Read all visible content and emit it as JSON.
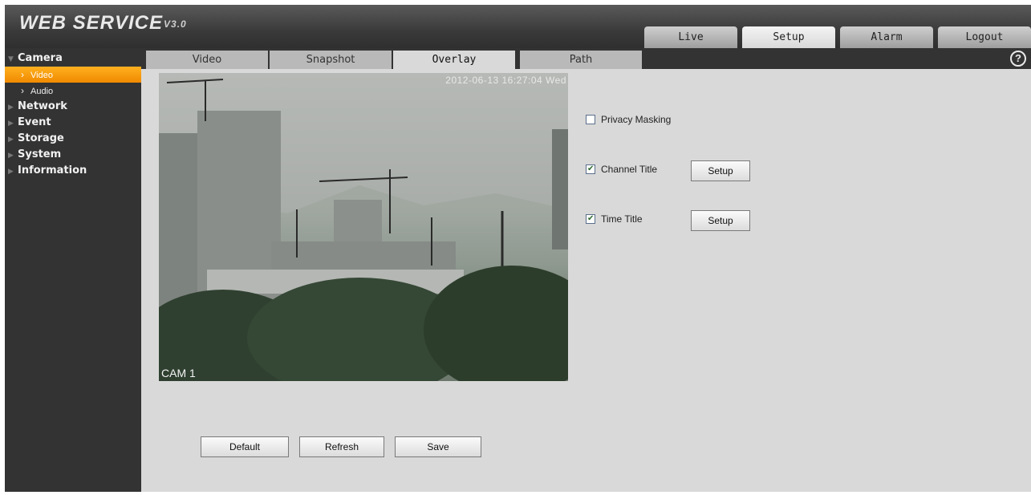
{
  "header": {
    "logo": "WEB SERVICE",
    "version": "V3.0",
    "nav": [
      "Live",
      "Setup",
      "Alarm",
      "Logout"
    ],
    "active_nav": "Setup"
  },
  "sidebar": {
    "sections": [
      {
        "label": "Camera",
        "expanded": true,
        "items": [
          {
            "label": "Video",
            "active": true
          },
          {
            "label": "Audio",
            "active": false
          }
        ]
      },
      {
        "label": "Network"
      },
      {
        "label": "Event"
      },
      {
        "label": "Storage"
      },
      {
        "label": "System"
      },
      {
        "label": "Information"
      }
    ]
  },
  "tabs": [
    "Video",
    "Snapshot",
    "Overlay",
    "Path"
  ],
  "active_tab": "Overlay",
  "help_label": "?",
  "video": {
    "time_osd": "2012-06-13 16:27:04 Wed",
    "channel_osd": "CAM 1"
  },
  "options": {
    "privacy_masking": {
      "label": "Privacy Masking",
      "checked": false
    },
    "channel_title": {
      "label": "Channel Title",
      "checked": true,
      "setup_label": "Setup"
    },
    "time_title": {
      "label": "Time Title",
      "checked": true,
      "setup_label": "Setup"
    }
  },
  "actions": {
    "default": "Default",
    "refresh": "Refresh",
    "save": "Save"
  },
  "colors": {
    "accent": "#f5a000",
    "bg": "#333333",
    "panel": "#d9d9d9"
  }
}
